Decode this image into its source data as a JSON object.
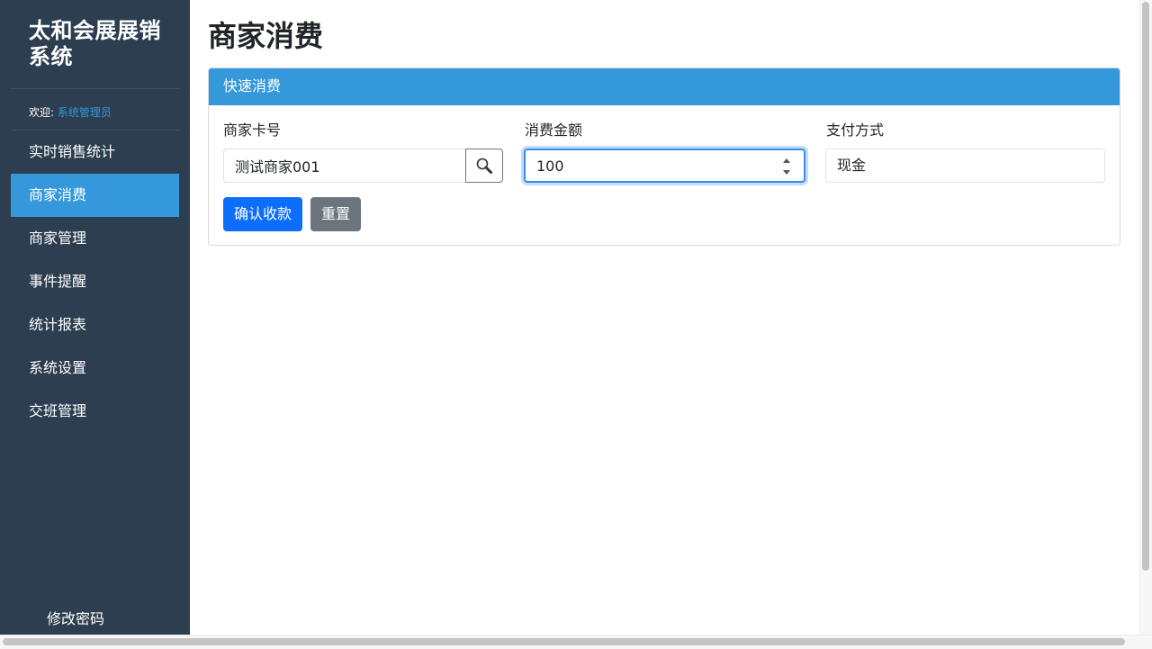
{
  "sidebar": {
    "brand": "太和会展展销系统",
    "welcome_label": "欢迎:",
    "welcome_user": "系统管理员",
    "items": [
      {
        "label": "实时销售统计"
      },
      {
        "label": "商家消费"
      },
      {
        "label": "商家管理"
      },
      {
        "label": "事件提醒"
      },
      {
        "label": "统计报表"
      },
      {
        "label": "系统设置"
      },
      {
        "label": "交班管理"
      }
    ],
    "active_index": 1,
    "change_password": "修改密码"
  },
  "main": {
    "page_title": "商家消费",
    "card_title": "快速消费",
    "form": {
      "card_no_label": "商家卡号",
      "card_no_value": "测试商家001",
      "amount_label": "消费金额",
      "amount_value": "100",
      "payment_label": "支付方式",
      "payment_value": "现金"
    },
    "buttons": {
      "confirm": "确认收款",
      "reset": "重置"
    }
  },
  "colors": {
    "sidebar_bg": "#2c3e50",
    "accent": "#3498db",
    "primary_button": "#0d6efd",
    "secondary_button": "#6c757d"
  },
  "icons": {
    "search": "magnifier-icon"
  }
}
